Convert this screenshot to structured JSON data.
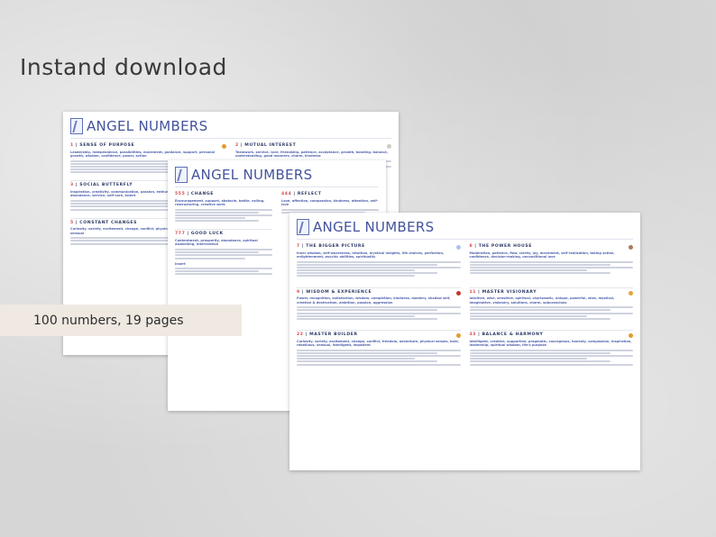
{
  "headline": "Instand download",
  "badge": "100 numbers, 19 pages",
  "sheet_title": "ANGEL NUMBERS",
  "page1": {
    "sections": [
      {
        "num": "1",
        "title": "SENSE OF PURPOSE",
        "keywords": "Leadership, independence, possibilities, movement, guidance, support, personal growth, wisdom, confidence, power, action",
        "color": "#e39b2f"
      },
      {
        "num": "2",
        "title": "MUTUAL INTEREST",
        "keywords": "Teamwork, service, love, friendship, patience, acceptance, growth, bonding, balance, understanding, good manners, charm, kindness",
        "color": "#c8d0c0"
      },
      {
        "num": "3",
        "title": "SOCIAL BUTTERFLY",
        "keywords": "Inspiration, creativity, communication, passion, enthusiasm, effort, creative, abundance, service, self-care, talent",
        "color": ""
      },
      {
        "num": "5",
        "title": "CONSTANT CHANGES",
        "keywords": "Curiosity, variety, excitement, change, conflict, physical senses, bold, rebellious, sensual",
        "color": ""
      }
    ]
  },
  "page2": {
    "sections": [
      {
        "num": "555",
        "title": "CHANGE",
        "keywords": "Encouragement, support, obstacle, battle, calling, restructuring, creative work",
        "color": ""
      },
      {
        "num": "444",
        "title": "REFLECT",
        "keywords": "Love, affection, compassion, kindness, attention, self-love",
        "color": ""
      },
      {
        "num": "777",
        "title": "GOOD LUCK",
        "keywords": "Contentment, prosperity, abundance, spiritual awakening, intervention",
        "color": ""
      }
    ],
    "footer_word": "Insert"
  },
  "page3": {
    "sections": [
      {
        "num": "7",
        "title": "THE BIGGER PICTURE",
        "keywords": "Inner wisdom, self-awareness, intuition, mystical insights, life choices, perfection, enlightenment, psychic abilities, spirituality",
        "color": "#a9c4e4"
      },
      {
        "num": "8",
        "title": "THE POWER HOUSE",
        "keywords": "Moderation, patience, flow, clarity, joy, movement, self-realization, taking action, confidence, decision-making, unconditional love",
        "color": "#b0785e"
      },
      {
        "num": "9",
        "title": "WISDOM & EXPERIENCE",
        "keywords": "Power, recognition, satisfaction, wisdom, completion, kindness, mastery, shadow self, creation & destruction, ambition, passion, aggression",
        "color": "#c0392b"
      },
      {
        "num": "11",
        "title": "MASTER VISIONARY",
        "keywords": "Intuitive, wise, sensitive, spiritual, charismatic, unique, powerful, wise, mystical, imaginative, visionary, solutions, charm, subconscious",
        "color": "#e8a43a"
      },
      {
        "num": "22",
        "title": "MASTER BUILDER",
        "keywords": "Curiosity, variety, excitement, change, conflict, freedom, adventure, physical senses, bold, rebellious, sensual, intelligent, impatient",
        "color": "#e39b2f"
      },
      {
        "num": "33",
        "title": "BALANCE & HARMONY",
        "keywords": "Intelligent, creative, supportive, pragmatic, courageous, honesty, compassion, inspiration, leadership, spiritual wisdom, life's purpose",
        "color": "#e39b2f"
      }
    ]
  }
}
